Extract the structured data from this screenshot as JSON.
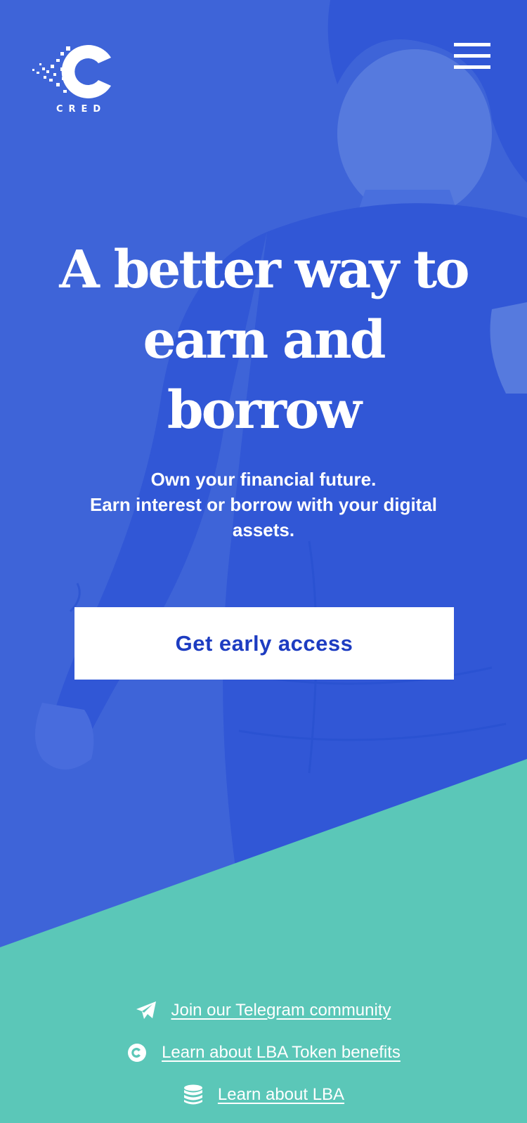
{
  "brand": {
    "wordmark": "CRED"
  },
  "header": {
    "menu_icon": "hamburger-menu-icon"
  },
  "hero": {
    "headline_lines": [
      "A better way to",
      "earn and",
      "borrow"
    ],
    "subtitle_lines": [
      "Own your financial future.",
      "Earn interest or borrow with your digital assets."
    ]
  },
  "cta": {
    "label": "Get early access"
  },
  "links": [
    {
      "icon": "telegram-icon",
      "label": "Join our Telegram community"
    },
    {
      "icon": "cred-coin-icon",
      "label": "Learn about LBA Token benefits"
    },
    {
      "icon": "coin-stack-icon",
      "label": "Learn about LBA"
    }
  ],
  "colors": {
    "hero_background": "#3e64d8",
    "footer_background": "#5bc7b8",
    "button_text": "#1d3cc1",
    "text": "#ffffff"
  }
}
